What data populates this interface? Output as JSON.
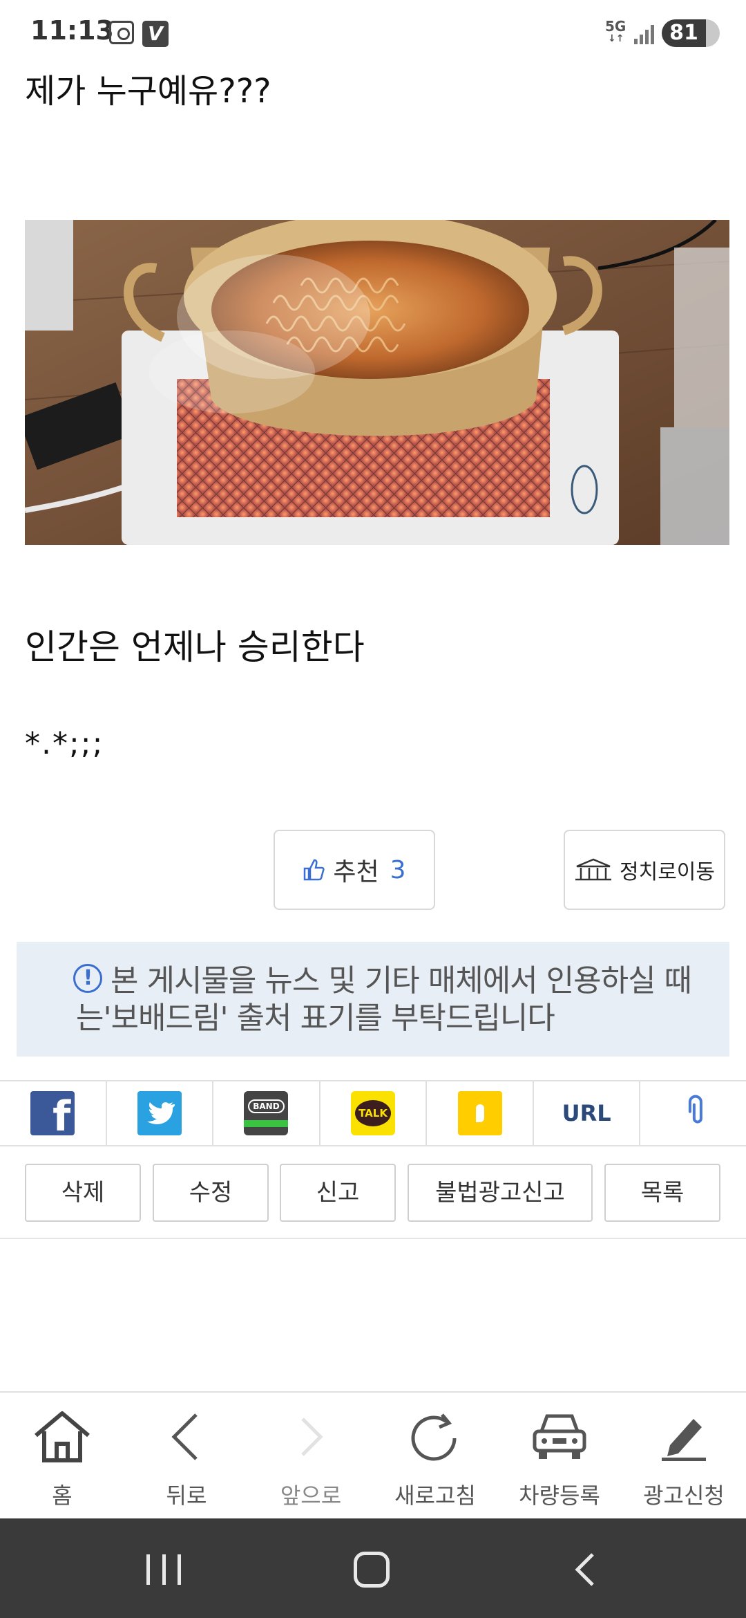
{
  "status_bar": {
    "time": "11:13",
    "network": "5G",
    "battery": "81"
  },
  "post": {
    "title": "제가 누구예유???",
    "photo_icon": "ramen-pot-on-heater-photo",
    "line1": "인간은 언제나 승리한다",
    "line2": "*.*;;;"
  },
  "recommend": {
    "label": "추천",
    "count": "3"
  },
  "move": {
    "label": "정치로이동"
  },
  "notice": {
    "text": "본 게시물을 뉴스 및 기타 매체에서 인용하실 때는'보배드림' 출처 표기를 부탁드립니다"
  },
  "share": {
    "band_text": "BAND",
    "kakao_text": "TALK",
    "url_text": "URL"
  },
  "actions": {
    "delete": "삭제",
    "edit": "수정",
    "report": "신고",
    "ad_report": "불법광고신고",
    "list": "목록"
  },
  "bottom_nav": {
    "home": "홈",
    "back": "뒤로",
    "forward": "앞으로",
    "refresh": "새로고침",
    "car_register": "차량등록",
    "ad_request": "광고신청"
  },
  "colors": {
    "accent": "#3a6fd0",
    "notice_bg": "#e8eef6",
    "system_nav_bg": "#3a3a3a"
  }
}
